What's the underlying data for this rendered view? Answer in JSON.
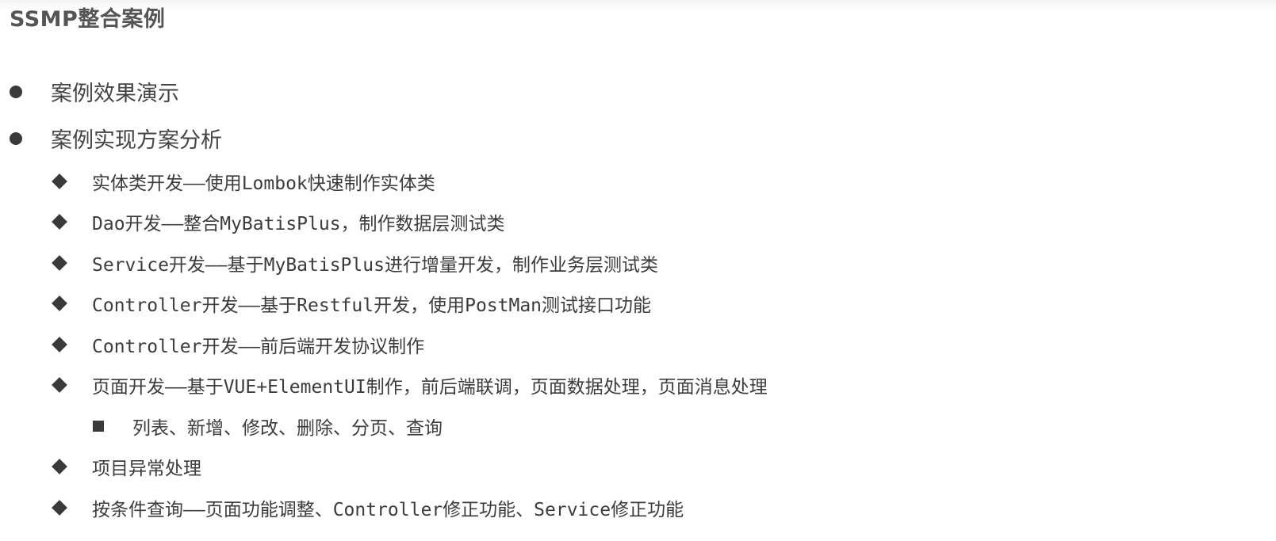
{
  "slide": {
    "title": "SSMP整合案例"
  },
  "outline": {
    "item_1": "案例效果演示",
    "item_2": "案例实现方案分析",
    "sub_1": "实体类开发——使用Lombok快速制作实体类",
    "sub_2": "Dao开发——整合MyBatisPlus，制作数据层测试类",
    "sub_3": "Service开发——基于MyBatisPlus进行增量开发，制作业务层测试类",
    "sub_4": "Controller开发——基于Restful开发，使用PostMan测试接口功能",
    "sub_5": "Controller开发——前后端开发协议制作",
    "sub_6": "页面开发——基于VUE+ElementUI制作，前后端联调，页面数据处理，页面消息处理",
    "sub_6_1": "列表、新增、修改、删除、分页、查询",
    "sub_7": "项目异常处理",
    "sub_8": "按条件查询——页面功能调整、Controller修正功能、Service修正功能"
  }
}
